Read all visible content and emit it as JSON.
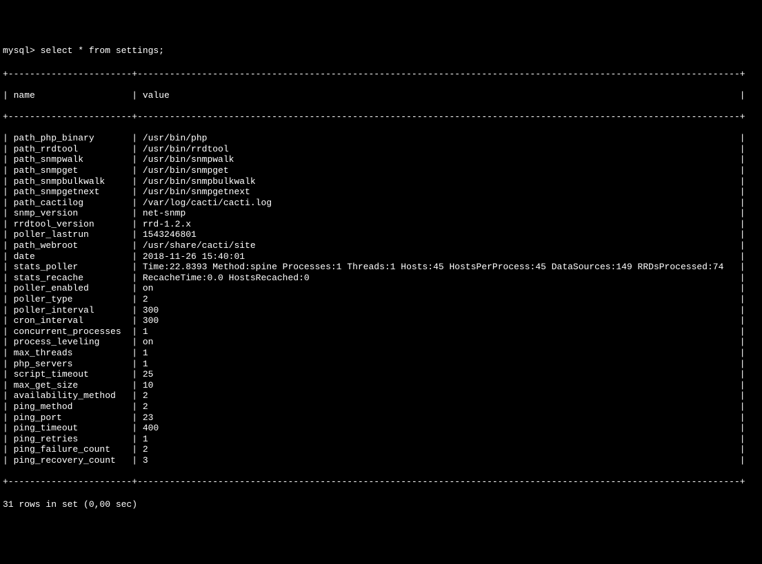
{
  "prompt": "mysql> select * from settings;",
  "columns": {
    "name_header": "name",
    "value_header": "value"
  },
  "rows": [
    {
      "name": "path_php_binary",
      "value": "/usr/bin/php"
    },
    {
      "name": "path_rrdtool",
      "value": "/usr/bin/rrdtool"
    },
    {
      "name": "path_snmpwalk",
      "value": "/usr/bin/snmpwalk"
    },
    {
      "name": "path_snmpget",
      "value": "/usr/bin/snmpget"
    },
    {
      "name": "path_snmpbulkwalk",
      "value": "/usr/bin/snmpbulkwalk"
    },
    {
      "name": "path_snmpgetnext",
      "value": "/usr/bin/snmpgetnext"
    },
    {
      "name": "path_cactilog",
      "value": "/var/log/cacti/cacti.log"
    },
    {
      "name": "snmp_version",
      "value": "net-snmp"
    },
    {
      "name": "rrdtool_version",
      "value": "rrd-1.2.x"
    },
    {
      "name": "poller_lastrun",
      "value": "1543246801"
    },
    {
      "name": "path_webroot",
      "value": "/usr/share/cacti/site"
    },
    {
      "name": "date",
      "value": "2018-11-26 15:40:01"
    },
    {
      "name": "stats_poller",
      "value": "Time:22.8393 Method:spine Processes:1 Threads:1 Hosts:45 HostsPerProcess:45 DataSources:149 RRDsProcessed:74"
    },
    {
      "name": "stats_recache",
      "value": "RecacheTime:0.0 HostsRecached:0"
    },
    {
      "name": "poller_enabled",
      "value": "on"
    },
    {
      "name": "poller_type",
      "value": "2"
    },
    {
      "name": "poller_interval",
      "value": "300"
    },
    {
      "name": "cron_interval",
      "value": "300"
    },
    {
      "name": "concurrent_processes",
      "value": "1"
    },
    {
      "name": "process_leveling",
      "value": "on"
    },
    {
      "name": "max_threads",
      "value": "1"
    },
    {
      "name": "php_servers",
      "value": "1"
    },
    {
      "name": "script_timeout",
      "value": "25"
    },
    {
      "name": "max_get_size",
      "value": "10"
    },
    {
      "name": "availability_method",
      "value": "2"
    },
    {
      "name": "ping_method",
      "value": "2"
    },
    {
      "name": "ping_port",
      "value": "23"
    },
    {
      "name": "ping_timeout",
      "value": "400"
    },
    {
      "name": "ping_retries",
      "value": "1"
    },
    {
      "name": "ping_failure_count",
      "value": "2"
    },
    {
      "name": "ping_recovery_count",
      "value": "3"
    }
  ],
  "footer": "31 rows in set (0,00 sec)",
  "layout": {
    "name_col_width": 21,
    "value_col_width": 110
  }
}
